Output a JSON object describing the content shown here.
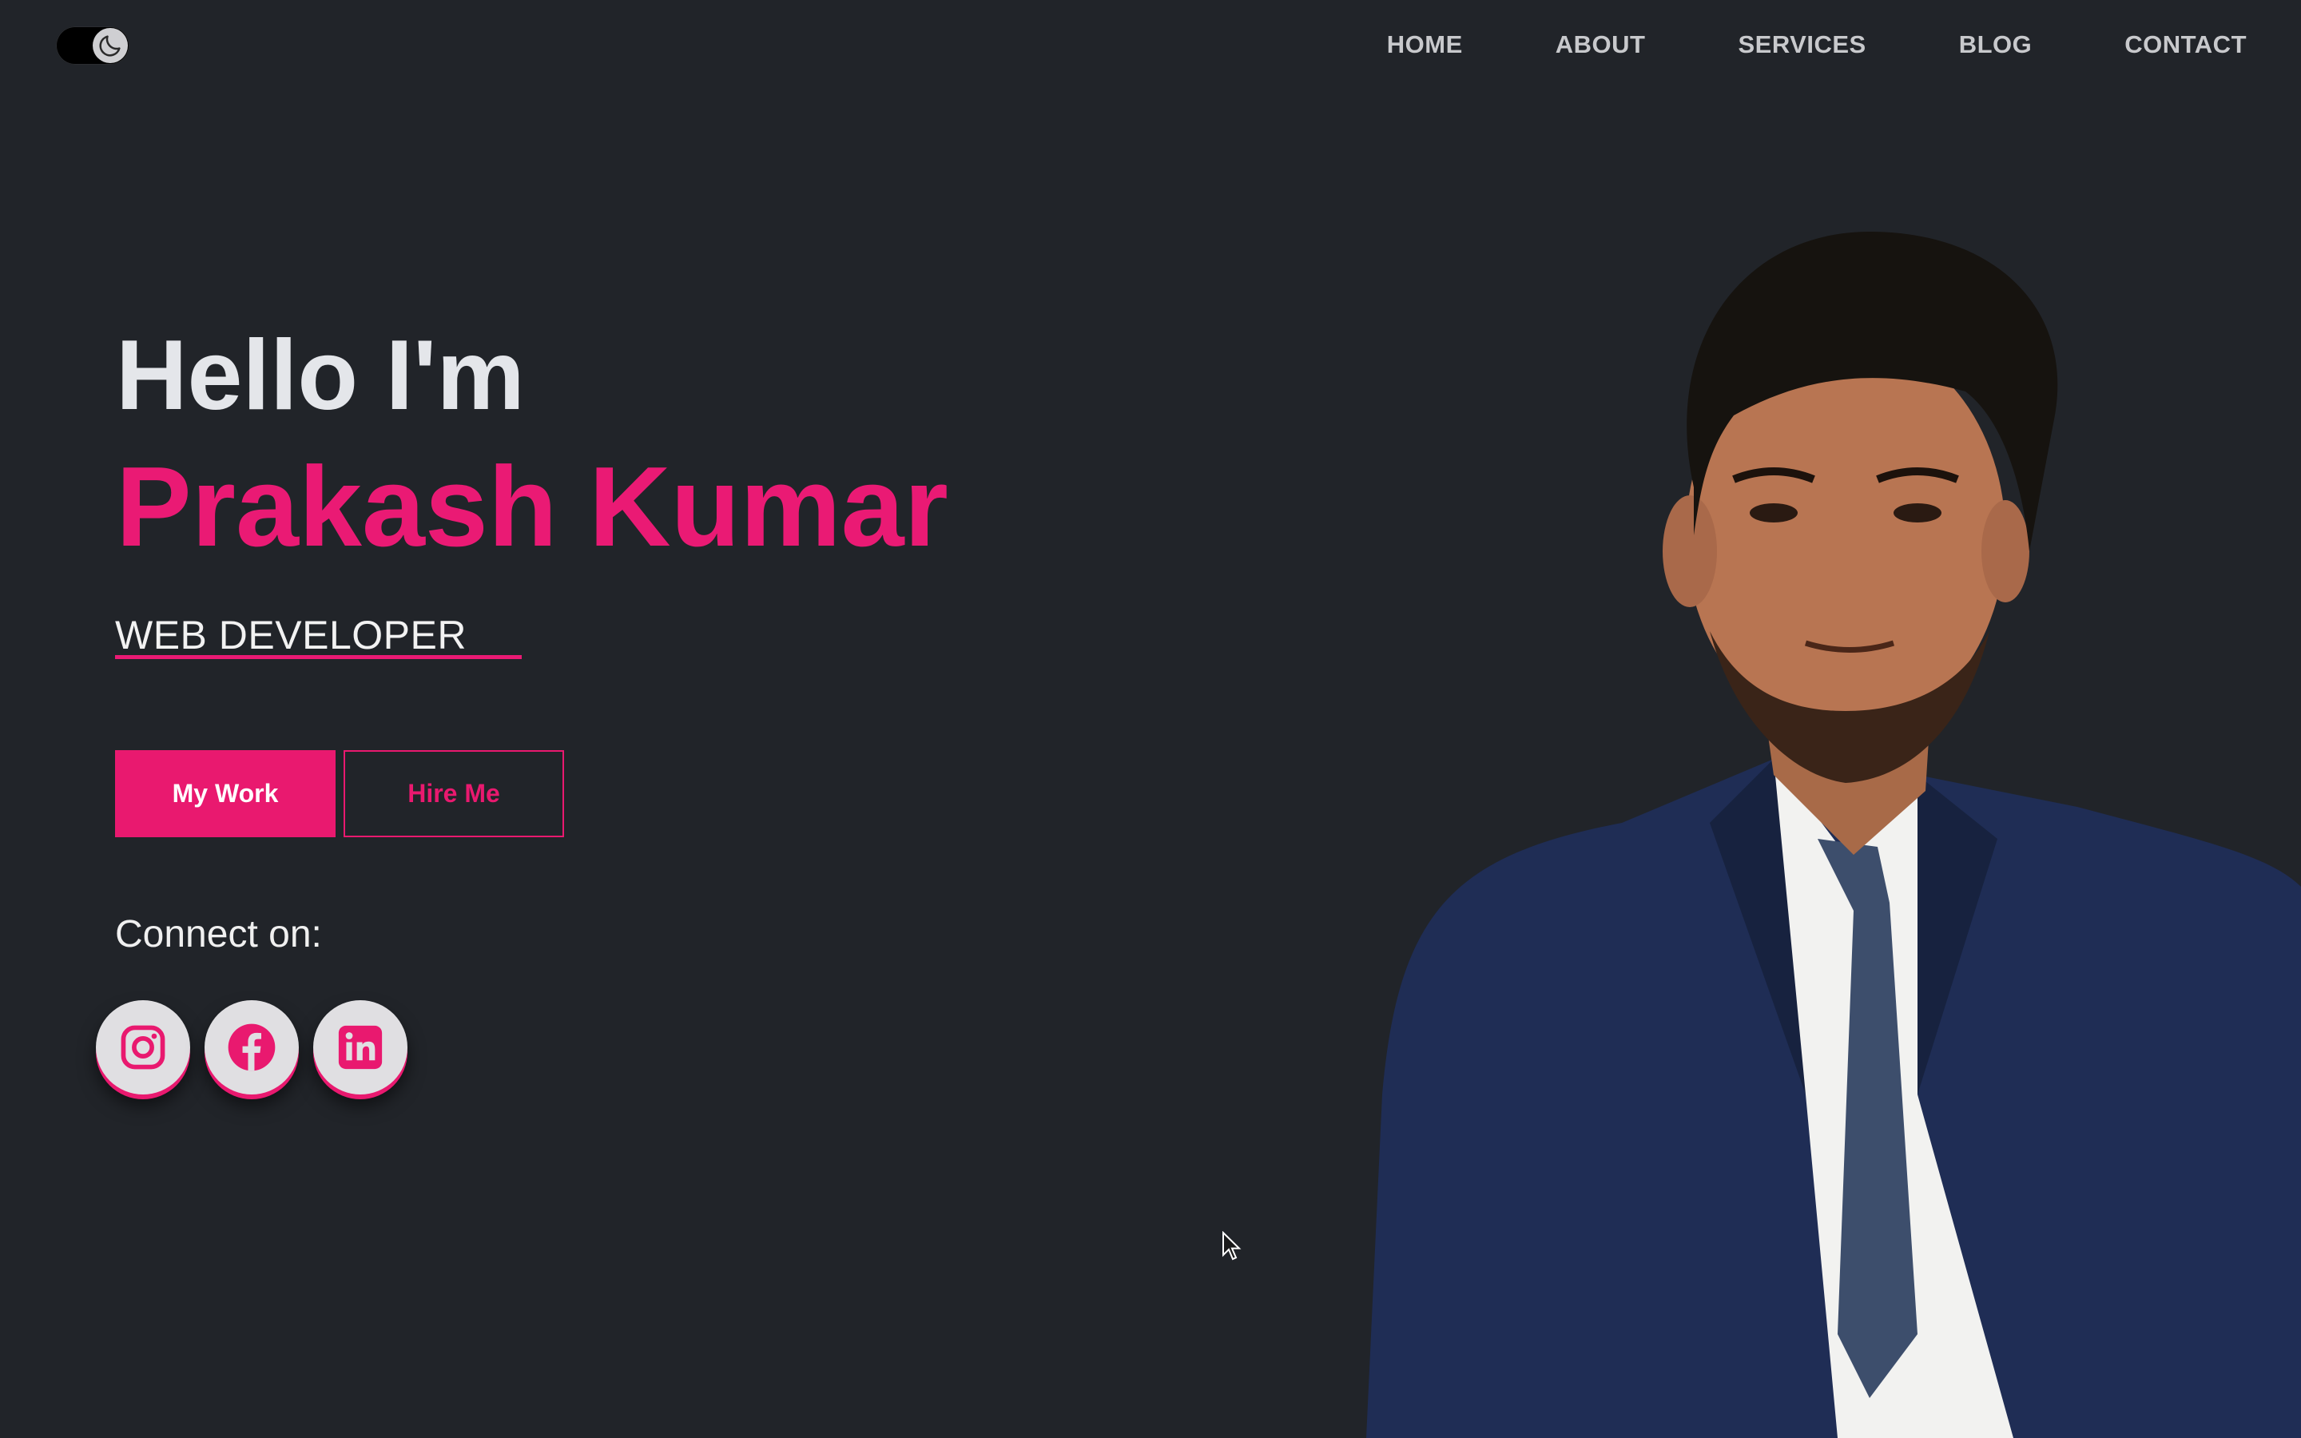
{
  "theme_toggle": {
    "icon": "moon-icon",
    "state": "dark"
  },
  "nav": {
    "items": [
      {
        "label": "HOME"
      },
      {
        "label": "ABOUT"
      },
      {
        "label": "SERVICES"
      },
      {
        "label": "BLOG"
      },
      {
        "label": "CONTACT"
      }
    ]
  },
  "hero": {
    "greeting": "Hello I'm",
    "name": "Prakash Kumar",
    "role": "WEB DEVELOPER"
  },
  "buttons": {
    "primary_label": "My Work",
    "secondary_label": "Hire Me"
  },
  "connect": {
    "label": "Connect on:",
    "socials": [
      {
        "icon": "instagram-icon"
      },
      {
        "icon": "facebook-icon"
      },
      {
        "icon": "linkedin-icon"
      }
    ]
  },
  "colors": {
    "background": "#212429",
    "accent": "#ea1a74",
    "nav_text": "#c8c9cc",
    "social_bg": "#e0dfe2"
  }
}
